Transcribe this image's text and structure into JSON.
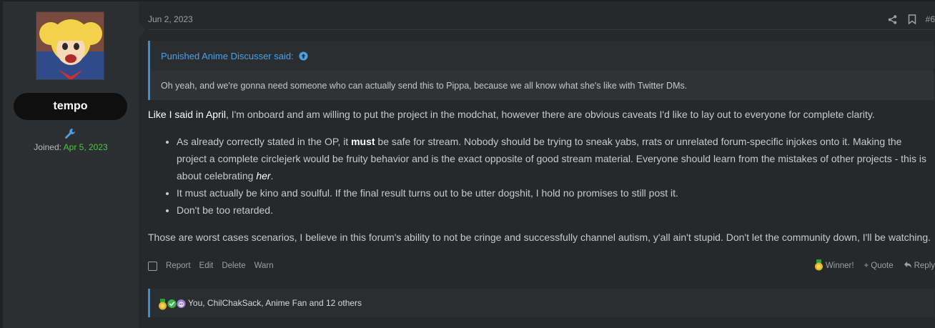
{
  "user": {
    "name": "tempo",
    "joined_label": "Joined:",
    "joined_date": "Apr 5, 2023"
  },
  "post": {
    "date": "Jun 2, 2023",
    "number": "#6",
    "quote": {
      "author": "Punished Anime Discusser said:",
      "text": "Oh yeah, and we're gonna need someone who can actually send this to Pippa, because we all know what she's like with Twitter DMs."
    },
    "body": {
      "lead_link": "Like I said in April",
      "intro": ", I'm onboard and am willing to put the project in the modchat, however there are obvious caveats I'd like to lay out to everyone for complete clarity.",
      "bullet1_a": "As already correctly stated in the OP, it ",
      "bullet1_bold": "must",
      "bullet1_b": " be safe for stream. Nobody should be trying to sneak yabs, rrats or unrelated forum-specific injokes onto it. Making the project a complete circlejerk would be fruity behavior and is the exact opposite of good stream material. Everyone should learn from the mistakes of other projects - this is about celebrating ",
      "bullet1_italic": "her",
      "bullet1_c": ".",
      "bullet2": "It must actually be kino and soulful. If the final result turns out to be utter dogshit, I hold no promises to still post it.",
      "bullet3": "Don't be too retarded.",
      "closing": "Those are worst cases scenarios, I believe in this forum's ability to not be cringe and successfully channel autism, y'all ain't stupid. Don't let the community down, I'll be watching."
    }
  },
  "actions": {
    "report": "Report",
    "edit": "Edit",
    "delete": "Delete",
    "warn": "Warn",
    "winner": "Winner!",
    "quote": "Quote",
    "reply": "Reply"
  },
  "reactions": {
    "icons": [
      "medal-icon",
      "check-icon",
      "anime-face-icon"
    ],
    "text": "You, ChilChakSack, Anime Fan and 12 others"
  },
  "colors": {
    "accent": "#3a8ed6",
    "joined_date": "#49c93d"
  }
}
